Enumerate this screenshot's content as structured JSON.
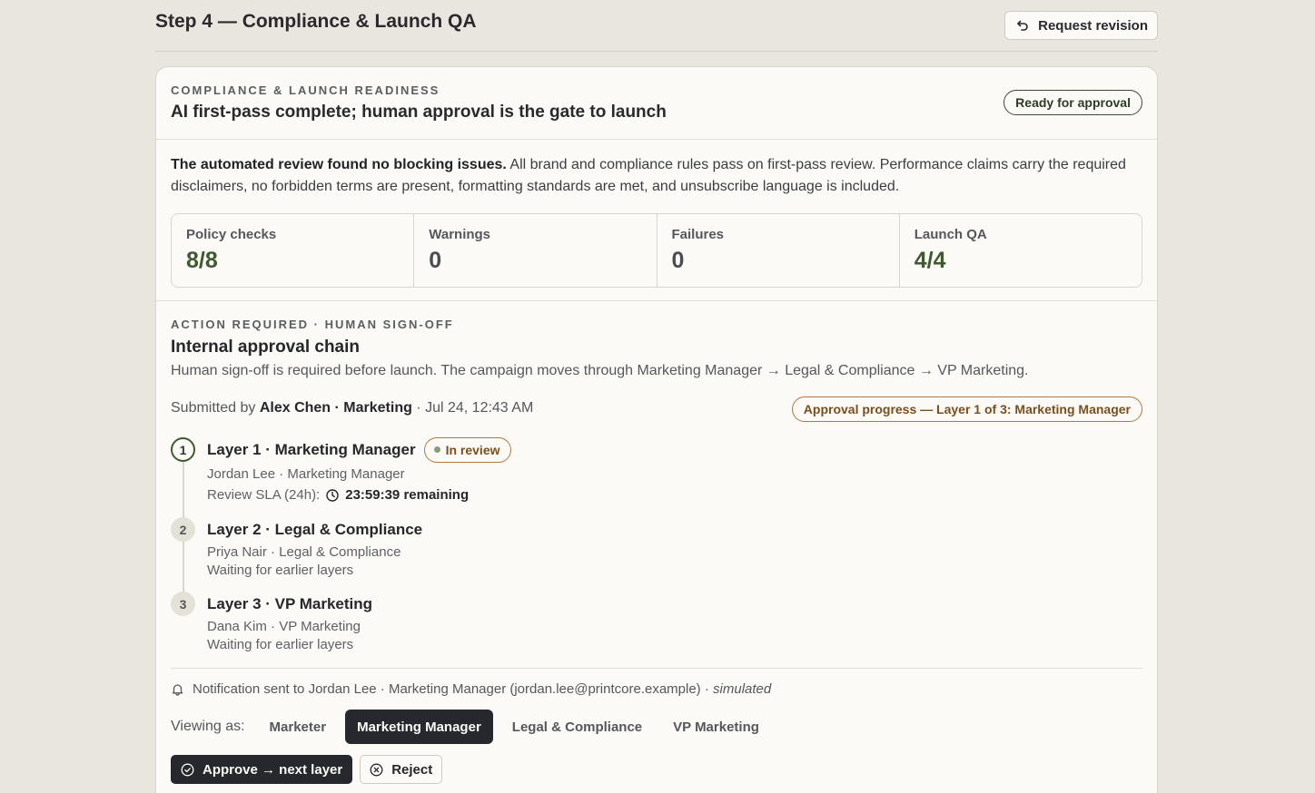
{
  "page": {
    "title": "Step 4 — Compliance & Launch QA",
    "request_revision_label": "Request revision"
  },
  "readiness": {
    "eyebrow": "COMPLIANCE & LAUNCH READINESS",
    "title": "AI first-pass complete; human approval is the gate to launch",
    "badge": "Ready for approval",
    "summary_bold": "The automated review found no blocking issues.",
    "summary_text": " All brand and compliance rules pass on first-pass review. Performance claims carry the required disclaimers, no forbidden terms are present, formatting standards are met, and unsubscribe language is included.",
    "stats": [
      {
        "label": "Policy checks",
        "value": "8/8"
      },
      {
        "label": "Warnings",
        "value": "0"
      },
      {
        "label": "Failures",
        "value": "0"
      },
      {
        "label": "Launch QA",
        "value": "4/4"
      }
    ]
  },
  "approval": {
    "eyebrow": "ACTION REQUIRED · HUMAN SIGN-OFF",
    "title": "Internal approval chain",
    "description": "Human sign-off is required before launch. The campaign moves through Marketing Manager → Legal & Compliance → VP Marketing.",
    "submitted_prefix": "Submitted by ",
    "submitted_by": "Alex Chen · Marketing",
    "submitted_time": " · Jul 24, 12:43 AM",
    "progress_badge": "Approval progress — Layer 1 of 3: Marketing Manager",
    "layers": [
      {
        "num": "1",
        "title": "Layer 1 · Marketing Manager",
        "status": "In review",
        "person": "Jordan Lee · Marketing Manager",
        "sla_label": "Review SLA (24h):",
        "sla_value": "23:59:39 remaining"
      },
      {
        "num": "2",
        "title": "Layer 2 · Legal & Compliance",
        "person": "Priya Nair · Legal & Compliance",
        "status_text": "Waiting for earlier layers"
      },
      {
        "num": "3",
        "title": "Layer 3 · VP Marketing",
        "person": "Dana Kim · VP Marketing",
        "status_text": "Waiting for earlier layers"
      }
    ],
    "notification": "Notification sent to Jordan Lee · Marketing Manager (jordan.lee@printcore.example)",
    "notification_suffix": " · simulated",
    "viewing_label": "Viewing as:",
    "roles": [
      "Marketer",
      "Marketing Manager",
      "Legal & Compliance",
      "VP Marketing"
    ],
    "active_role": "Marketing Manager",
    "approve_label": "Approve → next layer",
    "reject_label": "Reject"
  }
}
